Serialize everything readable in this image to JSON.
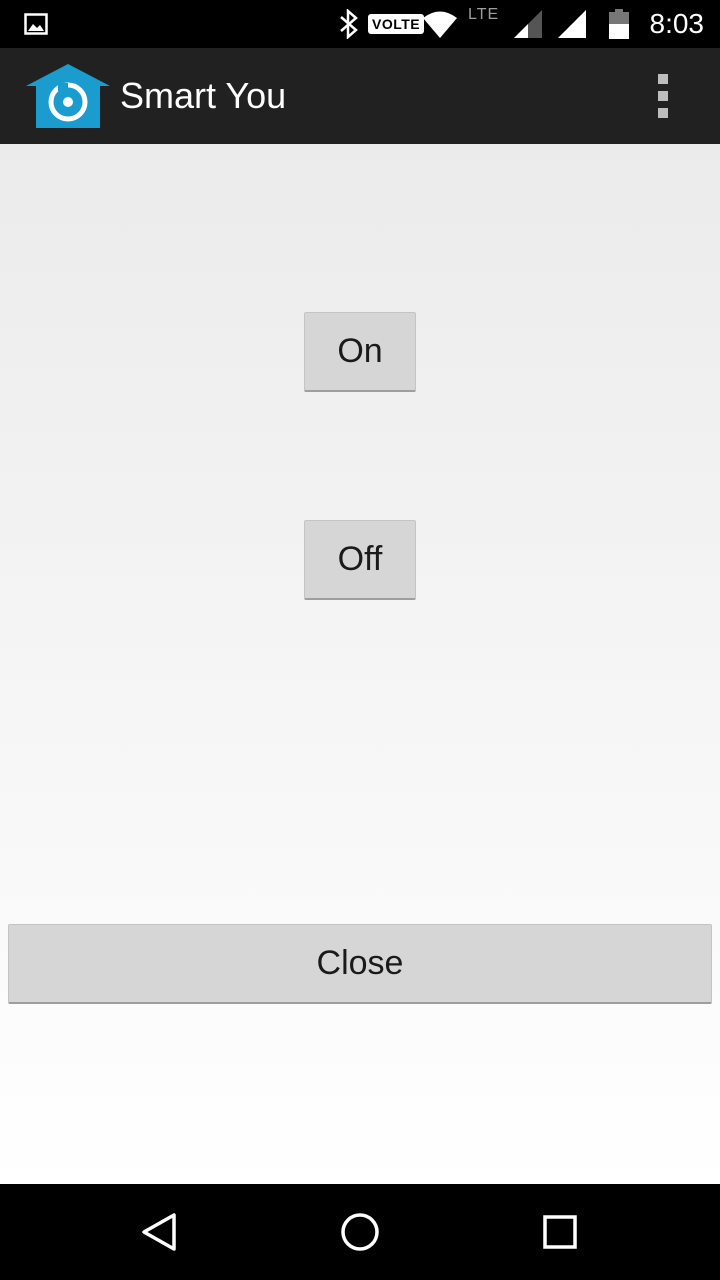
{
  "status_bar": {
    "time": "8:03",
    "volte_label": "VOLTE",
    "lte_label": "LTE",
    "icons": [
      "image-notification-icon",
      "bluetooth-icon",
      "volte-icon",
      "wifi-icon",
      "lte-icon",
      "signal-icon",
      "signal-full-icon",
      "battery-icon"
    ]
  },
  "action_bar": {
    "title": "Smart You",
    "logo_color": "#1a9ccf",
    "menu_icon": "overflow-menu-icon"
  },
  "main": {
    "on_label": "On",
    "off_label": "Off",
    "close_label": "Close"
  },
  "nav_bar": {
    "icons": [
      "back-icon",
      "home-icon",
      "recents-icon"
    ]
  }
}
